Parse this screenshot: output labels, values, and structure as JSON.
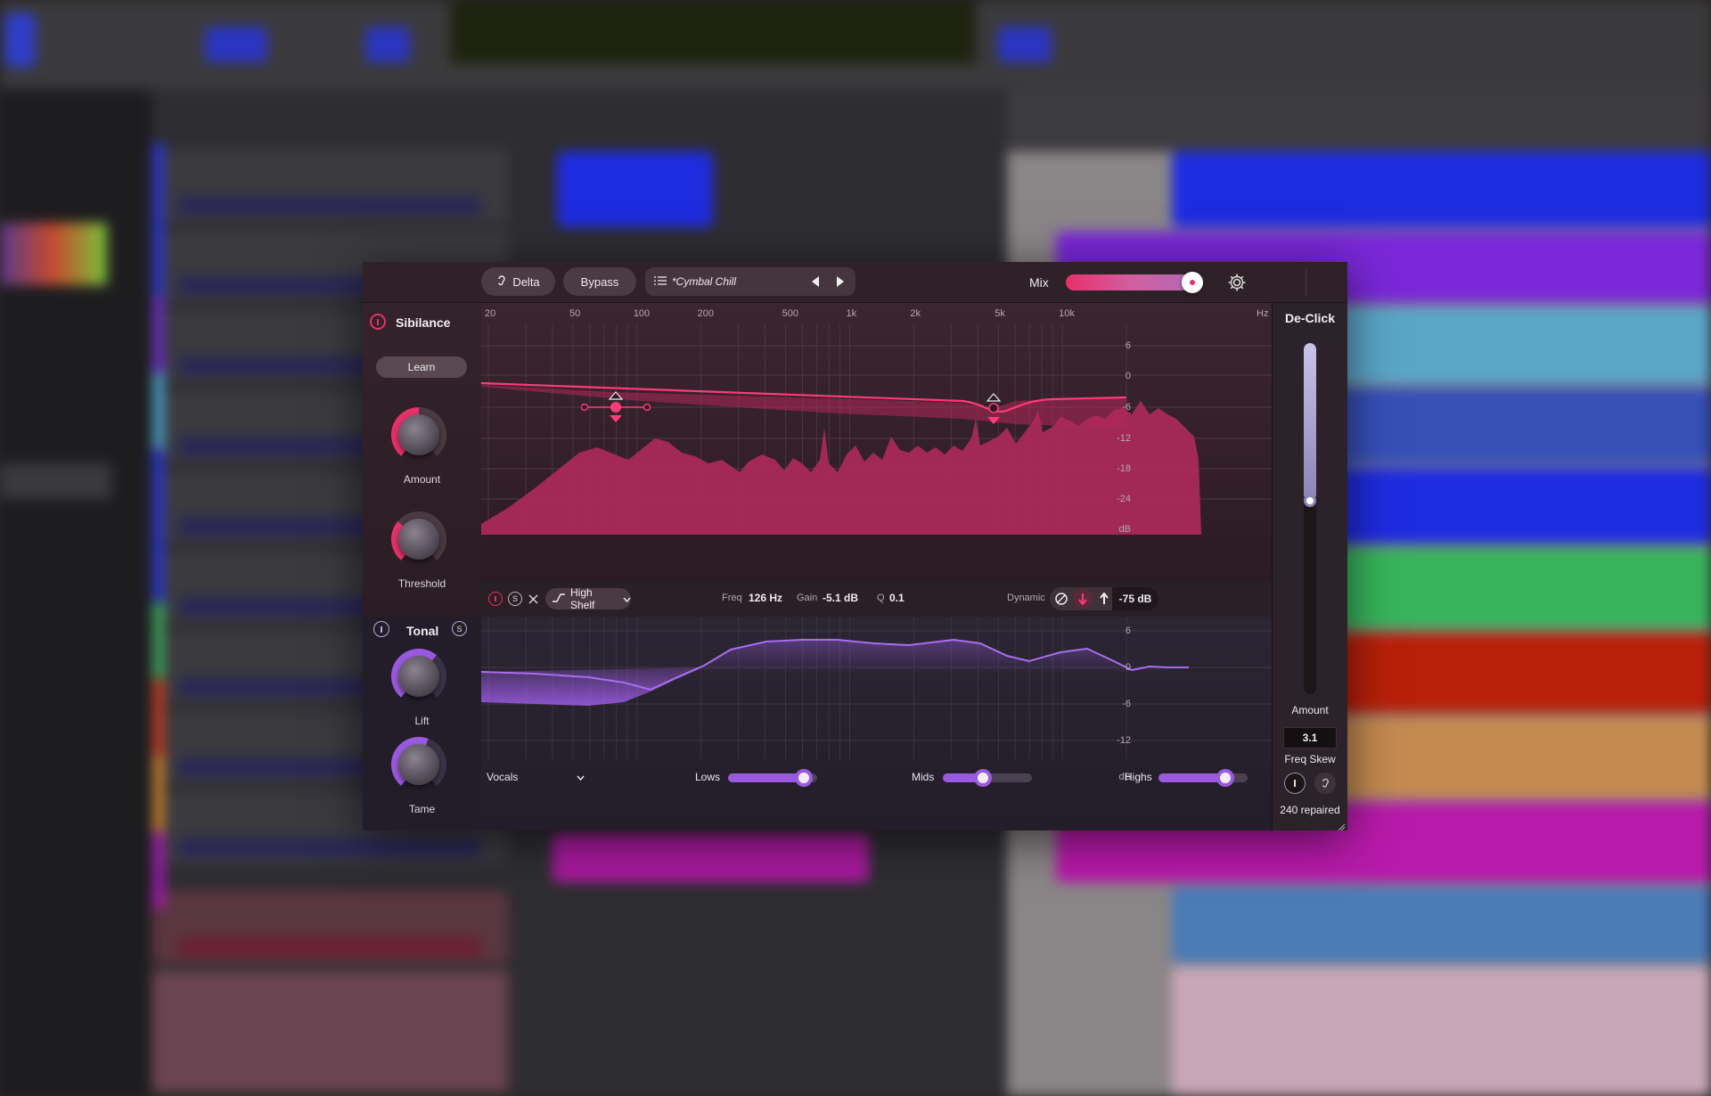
{
  "plugin": {
    "topbar": {
      "delta_label": "Delta",
      "bypass_label": "Bypass",
      "preset_name": "*Cymbal Chill",
      "mix_label": "Mix"
    },
    "sibilance": {
      "title": "Sibilance",
      "learn_label": "Learn",
      "amount_label": "Amount",
      "threshold_label": "Threshold"
    },
    "freq_axis": [
      "20",
      "50",
      "100",
      "200",
      "500",
      "1k",
      "2k",
      "5k",
      "10k",
      "Hz"
    ],
    "db_axis_top": [
      "6",
      "0",
      "-6",
      "-12",
      "-18",
      "-24",
      "dB"
    ],
    "eq_controls": {
      "shape_label": "High Shelf",
      "freq_label": "Freq",
      "freq_value": "126 Hz",
      "gain_label": "Gain",
      "gain_value": "-5.1 dB",
      "q_label": "Q",
      "q_value": "0.1",
      "dynamic_label": "Dynamic",
      "dynamic_value": "-75 dB"
    },
    "tonal": {
      "title": "Tonal",
      "lift_label": "Lift",
      "tame_label": "Tame",
      "source_value": "Vocals",
      "db_axis": [
        "6",
        "0",
        "-6",
        "-12",
        "dB"
      ],
      "bands": [
        {
          "label": "Lows",
          "value": 0.85
        },
        {
          "label": "Mids",
          "value": 0.45
        },
        {
          "label": "Highs",
          "value": 0.75
        }
      ]
    },
    "declick": {
      "title": "De-Click",
      "amount_label": "Amount",
      "amount_level": 0.55,
      "freq_skew_value": "3.1",
      "freq_skew_label": "Freq Skew",
      "repaired_text": "240 repaired"
    },
    "colors": {
      "accent_pink": "#e8306a",
      "accent_purple": "#9a5ae0"
    }
  }
}
